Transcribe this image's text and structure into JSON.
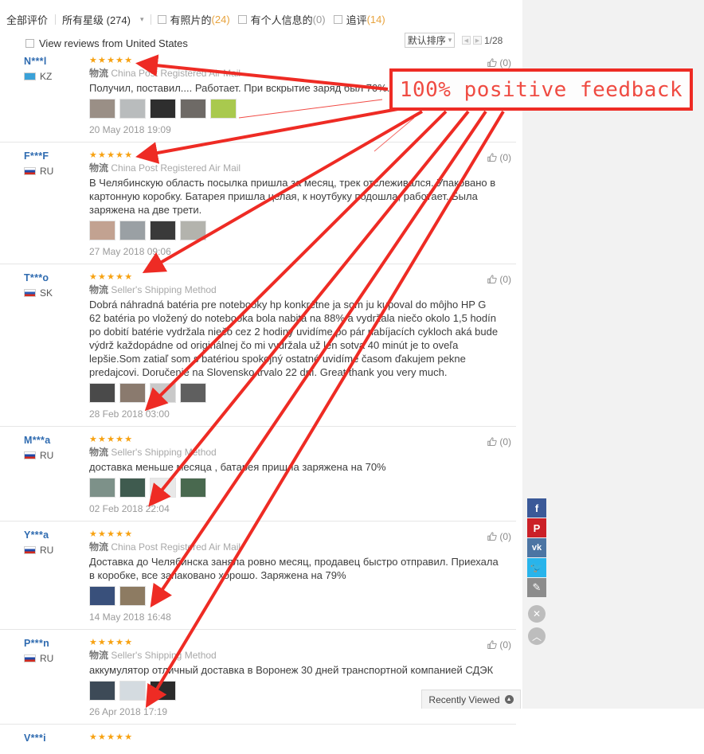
{
  "filter_bar": {
    "all_reviews": "全部评价",
    "all_stars": "所有星级 (274)",
    "with_photos_label": "有照片的",
    "with_photos_count": "(24)",
    "with_personal_label": "有个人信息的",
    "with_personal_count": "(0)",
    "followup_label": "追评",
    "followup_count": "(14)"
  },
  "view_row": {
    "label": "View reviews from United States",
    "sort_label": "默认排序",
    "page_indicator": "1/28",
    "prev_glyph": "◀",
    "next_glyph": "▶"
  },
  "annotation": {
    "text": "100% positive feedback",
    "border_color": "#ee2b24",
    "text_color": "#ef4b42"
  },
  "like_label": "(0)",
  "shipping_prefix": "物流",
  "reviews": [
    {
      "user": "N***l",
      "country": "KZ",
      "flag_class": "flag-kz",
      "stars": "★★★★★",
      "shipping": "China Post Registered Air Mail",
      "text": "Получил, поставил.... Работает. При вскрытие заряд был 70%.",
      "date": "20 May 2018 19:09",
      "likes": "(0)",
      "thumbs": [
        "#9a8f86",
        "#b9bcbd",
        "#2e2e2e",
        "#6e6a66",
        "#a9c94e"
      ]
    },
    {
      "user": "F***F",
      "country": "RU",
      "flag_class": "flag-ru",
      "stars": "★★★★★",
      "shipping": "China Post Registered Air Mail",
      "text": "В Челябинскую область посылка пришла за месяц, трек отслеживался. Упаковано в картонную коробку. Батарея пришла целая, к ноутбуку подошла, работает. Была заряжена на две трети.",
      "date": "27 May 2018 09:06",
      "likes": "(0)",
      "thumbs": [
        "#c2a291",
        "#9aa0a4",
        "#3a3a3a",
        "#b3b3ad"
      ]
    },
    {
      "user": "T***o",
      "country": "SK",
      "flag_class": "flag-sk",
      "stars": "★★★★★",
      "shipping": "Seller's Shipping Method",
      "text": "Dobrá náhradná batéria pre notebooky hp konkrétne ja som ju kupoval do môjho HP G 62 batéria po vložený do notebooka bola nabitá na 88% a vydržala niečo okolo 1,5 hodín po dobití batérie vydržala niečo cez 2 hodiny uvidíme po pár nabíjacích cykloch aká bude výdrž každopádne od originálnej čo mi vydržala už len sotva 40 minút je to oveľa lepšie.Som zatiaľ som s batériou spokojný ostatné uvidíme časom ďakujem pekne predajcovi. Doručenie na Slovensko trvalo 22 dní. Great thank you very much.",
      "date": "28 Feb 2018 03:00",
      "likes": "(0)",
      "thumbs": [
        "#4a4a4a",
        "#8a7a6e",
        "#c9c9c9",
        "#5f5f5f"
      ]
    },
    {
      "user": "M***a",
      "country": "RU",
      "flag_class": "flag-ru",
      "stars": "★★★★★",
      "shipping": "Seller's Shipping Method",
      "text": "доставка меньше месяца , батарея пришла заряжена на 70%",
      "date": "02 Feb 2018 22:04",
      "likes": "(0)",
      "thumbs": [
        "#7d9189",
        "#3f5b4f",
        "#e8e8e8",
        "#49694f"
      ]
    },
    {
      "user": "Y***a",
      "country": "RU",
      "flag_class": "flag-ru",
      "stars": "★★★★★",
      "shipping": "China Post Registered Air Mail",
      "text": "Доставка до Челябинска заняла ровно месяц, продавец быстро отправил. Приехала в коробке, все запаковано хорошо. Заряжена на 79%",
      "date": "14 May 2018 16:48",
      "likes": "(0)",
      "thumbs": [
        "#39507b",
        "#8d7b62"
      ]
    },
    {
      "user": "P***n",
      "country": "RU",
      "flag_class": "flag-ru",
      "stars": "★★★★★",
      "shipping": "Seller's Shipping Method",
      "text": "аккумулятор отличный доставка в Воронеж 30 дней транспортной компанией СДЭК",
      "date": "26 Apr 2018 17:19",
      "likes": "(0)",
      "thumbs": [
        "#3d4a57",
        "#d4dbe0",
        "#2b2b2b"
      ]
    },
    {
      "user": "V***i",
      "country": "",
      "flag_class": "",
      "stars": "★★★★★",
      "shipping": "",
      "text": "",
      "date": "",
      "likes": "",
      "thumbs": []
    }
  ],
  "rail": [
    {
      "name": "facebook",
      "glyph": "f",
      "cls": "rb-fb"
    },
    {
      "name": "pinterest",
      "glyph": "P",
      "cls": "rb-pin"
    },
    {
      "name": "vk",
      "glyph": "vk",
      "cls": "rb-vk"
    },
    {
      "name": "twitter",
      "glyph": "🐦",
      "cls": "rb-tw"
    },
    {
      "name": "edit-pencil",
      "glyph": "✎",
      "cls": "rb-pen"
    }
  ],
  "rail_close": "✕",
  "rail_up": "︿",
  "recently_viewed": {
    "label": "Recently Viewed",
    "toggle_glyph": "▲"
  }
}
